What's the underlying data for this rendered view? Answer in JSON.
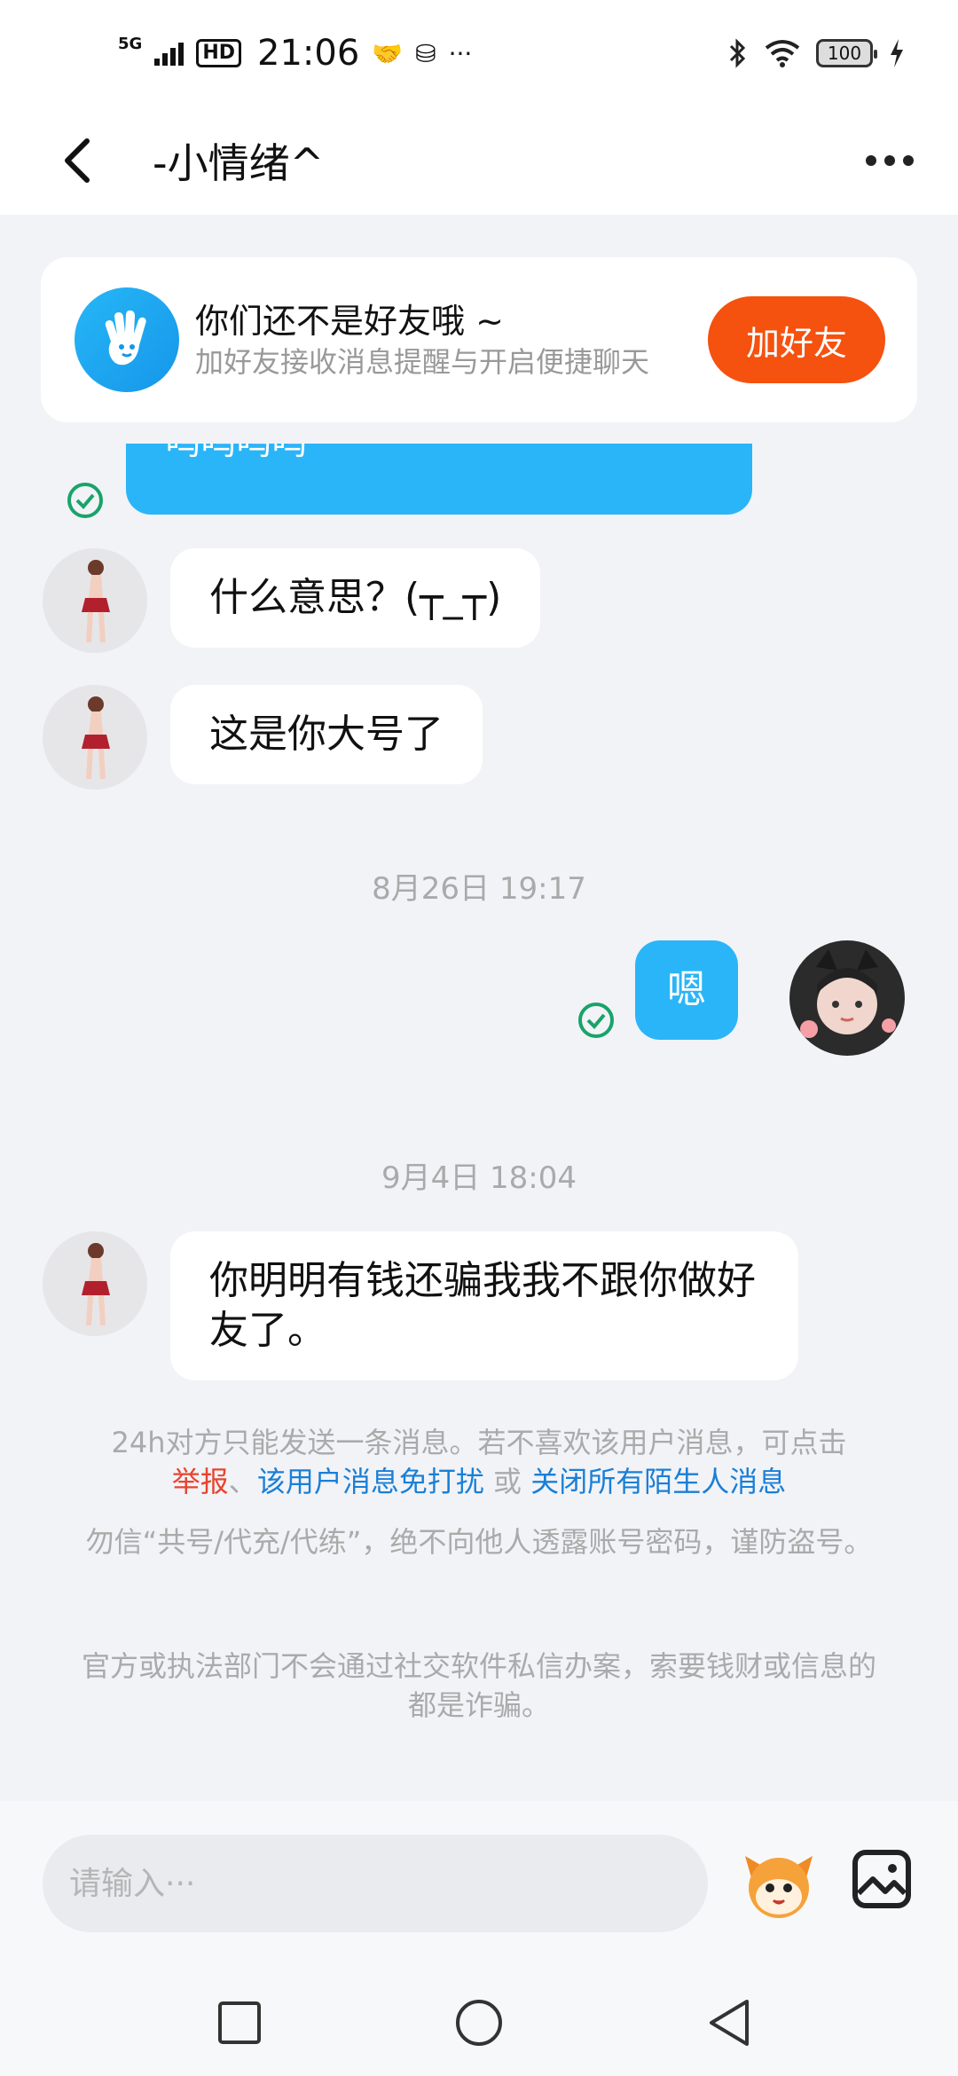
{
  "status_bar": {
    "network": "5G",
    "hd": "HD",
    "time": "21:06",
    "more": "···",
    "battery": "100"
  },
  "nav": {
    "title": "-小情绪^"
  },
  "friend_card": {
    "title": "你们还不是好友哦 ~",
    "subtitle": "加好友接收消息提醒与开启便捷聊天",
    "button": "加好友"
  },
  "messages": {
    "partial_out": "呜呜呜呜",
    "in_1": "什么意思？(┬_┬)",
    "in_2": "这是你大号了",
    "time_1": "8月26日 19:17",
    "out_1": "嗯",
    "time_2": "9月4日 18:04",
    "in_3": "你明明有钱还骗我我不跟你做好友了。"
  },
  "notice": {
    "limit_text": "24h对方只能发送一条消息。若不喜欢该用户消息，可点击",
    "report": "举报",
    "sep1": "、",
    "mute": "该用户消息免打扰",
    "or": " 或 ",
    "close_all": "关闭所有陌生人消息",
    "warning_1": "勿信“共号/代充/代练”，绝不向他人透露账号密码，谨防盗号。",
    "warning_2": "官方或执法部门不会通过社交软件私信办案，索要钱财或信息的都是诈骗。"
  },
  "input": {
    "placeholder": "请输入···"
  },
  "colors": {
    "accent_blue": "#2ab5f9",
    "add_friend_orange": "#f5510f",
    "report_red": "#e8442f",
    "link_blue": "#1a7fd6"
  }
}
